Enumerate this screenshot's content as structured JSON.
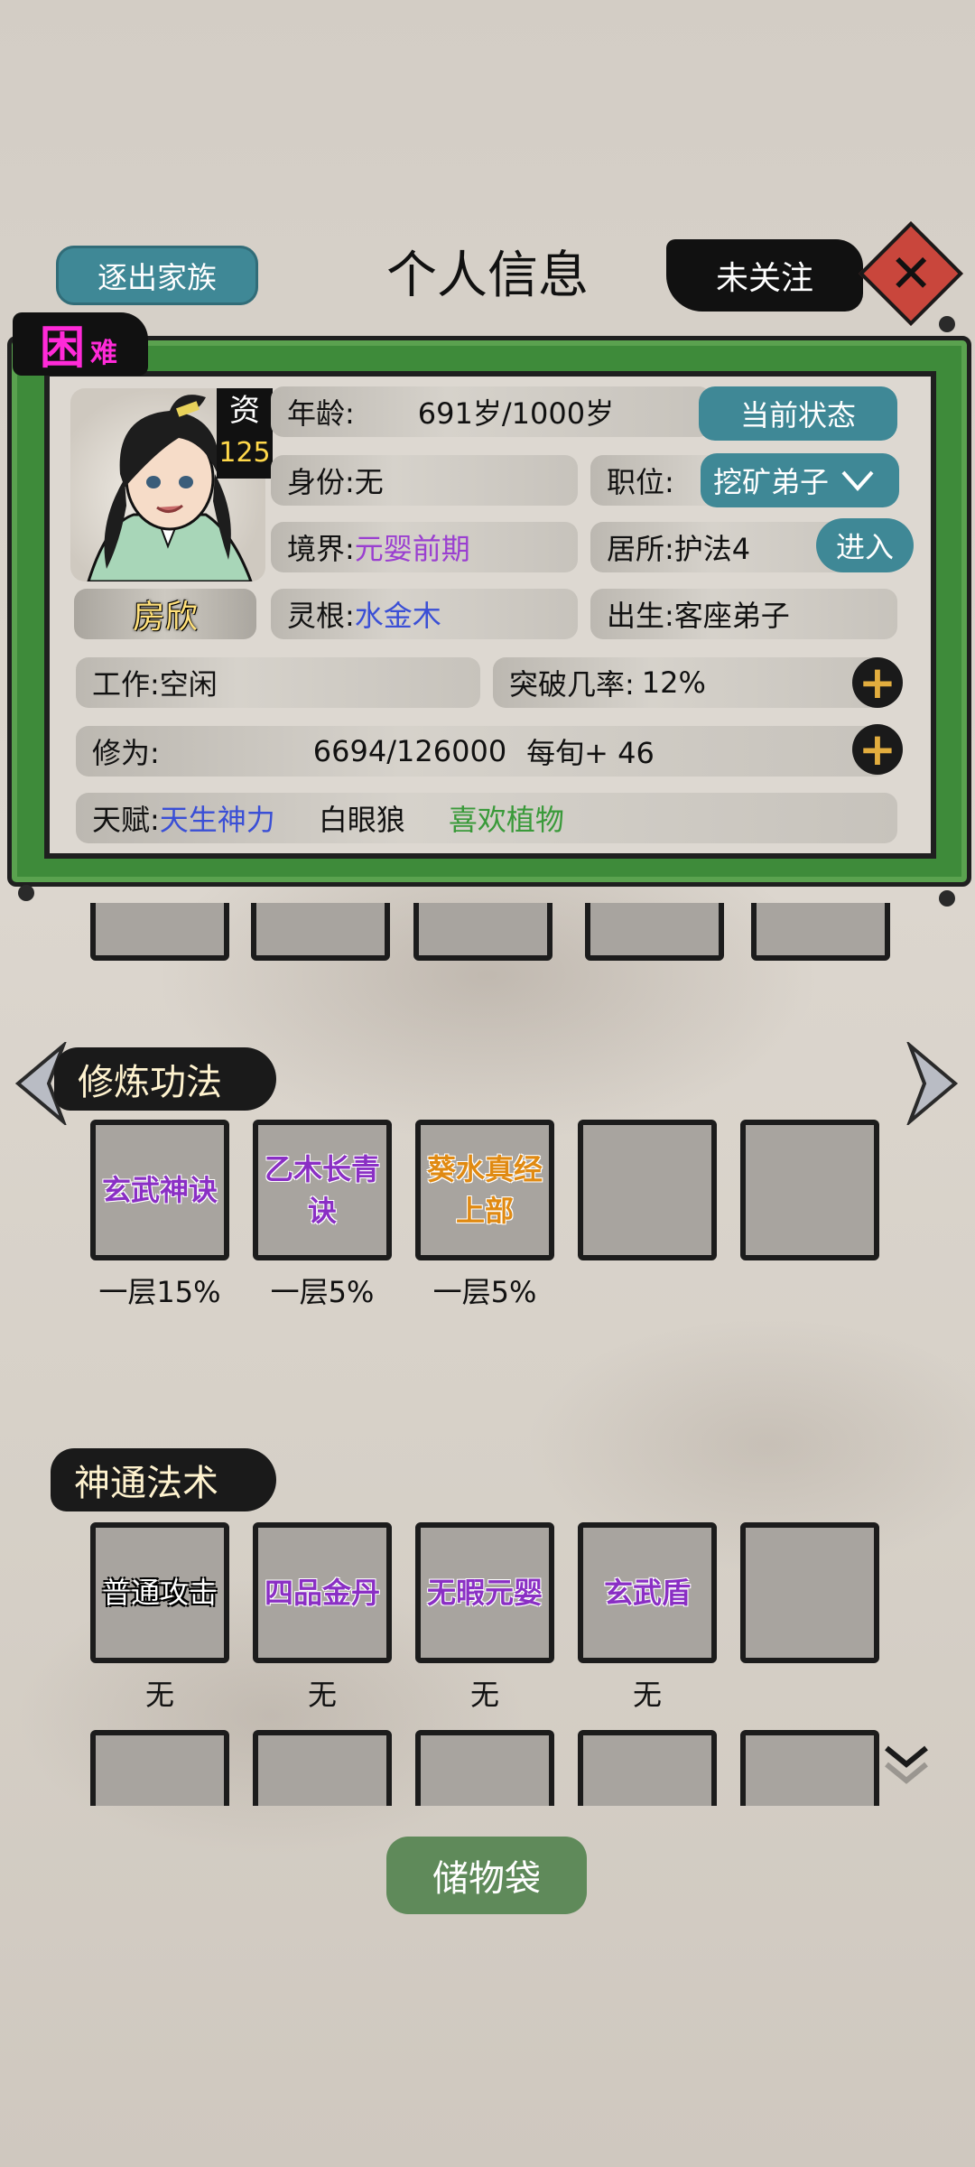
{
  "header": {
    "expel_label": "逐出家族",
    "title": "个人信息",
    "follow_label": "未关注",
    "close_glyph": "✕"
  },
  "difficulty": {
    "big": "困",
    "small": "难"
  },
  "character": {
    "aptitude_label": "资",
    "aptitude_value": "125",
    "name": "房欣",
    "age_label": "年龄:",
    "age_value": "691岁/1000岁",
    "status_button": "当前状态",
    "identity_label": "身份:",
    "identity_value": "无",
    "position_label": "职位:",
    "position_value": "挖矿弟子",
    "realm_label": "境界:",
    "realm_value": "元婴前期",
    "residence_label": "居所:",
    "residence_value": "护法4",
    "enter_button": "进入",
    "root_label": "灵根:",
    "root_value": "水金木",
    "origin_label": "出生:",
    "origin_value": "客座弟子",
    "work_label": "工作:",
    "work_value": "空闲",
    "breakthrough_label": "突破几率:",
    "breakthrough_value": "12%",
    "cultivation_label": "修为:",
    "cultivation_value": "6694/126000",
    "cultivation_rate": "每旬+ 46",
    "talent_label": "天赋:",
    "talents": [
      "天生神力",
      "白眼狼",
      "喜欢植物"
    ]
  },
  "techniques": {
    "title": "修炼功法",
    "items": [
      {
        "name": "玄武神诀",
        "level": "一层15%"
      },
      {
        "name": "乙木长青诀",
        "level": "一层5%"
      },
      {
        "name": "葵水真经上部",
        "level": "一层5%"
      },
      {
        "name": "",
        "level": ""
      },
      {
        "name": "",
        "level": ""
      }
    ]
  },
  "spells": {
    "title": "神通法术",
    "items": [
      {
        "name": "普通攻击",
        "level": "无"
      },
      {
        "name": "四品金丹",
        "level": "无"
      },
      {
        "name": "无暇元婴",
        "level": "无"
      },
      {
        "name": "玄武盾",
        "level": "无"
      },
      {
        "name": "",
        "level": ""
      }
    ]
  },
  "storage_button": "储物袋",
  "colors": {
    "teal_button": "#3f8896",
    "scroll_green": "#3e8b3a",
    "realm_purple": "#9a3fd0",
    "root_blue": "#3a4fd6",
    "talent_green": "#3a9a3a",
    "difficulty_magenta": "#ff2ad8"
  }
}
